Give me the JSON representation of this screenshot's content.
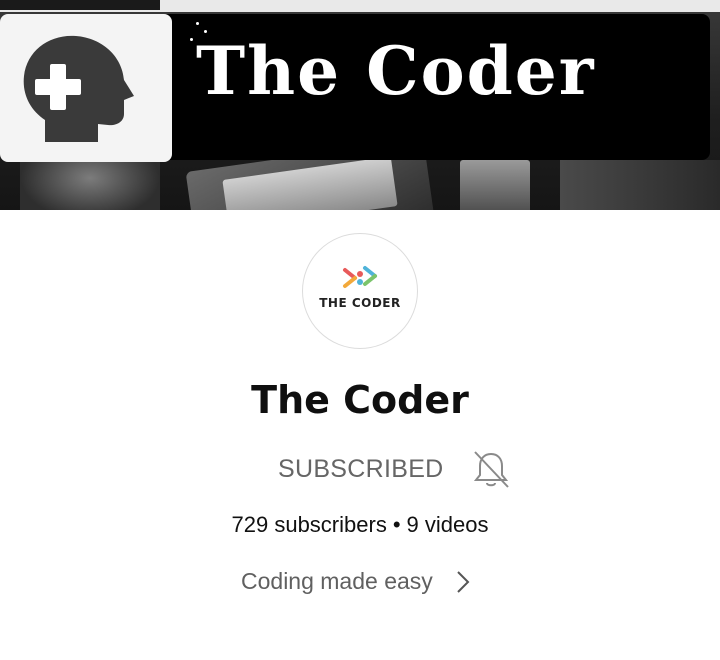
{
  "banner": {
    "title": "The Coder",
    "logo_icon": "head-plus-icon"
  },
  "avatar": {
    "text": "THE CODER",
    "icon": "colorful-network-icon",
    "colors": [
      "#e85a5a",
      "#f2a93b",
      "#4fb3d9",
      "#7bc46b"
    ]
  },
  "channel": {
    "name": "The Coder",
    "subscribe_label": "SUBSCRIBED",
    "bell_icon": "bell-off-icon",
    "subscribers": "729 subscribers",
    "separator": "•",
    "videos": "9 videos",
    "description": "Coding made easy",
    "more_icon": "chevron-right-icon"
  }
}
